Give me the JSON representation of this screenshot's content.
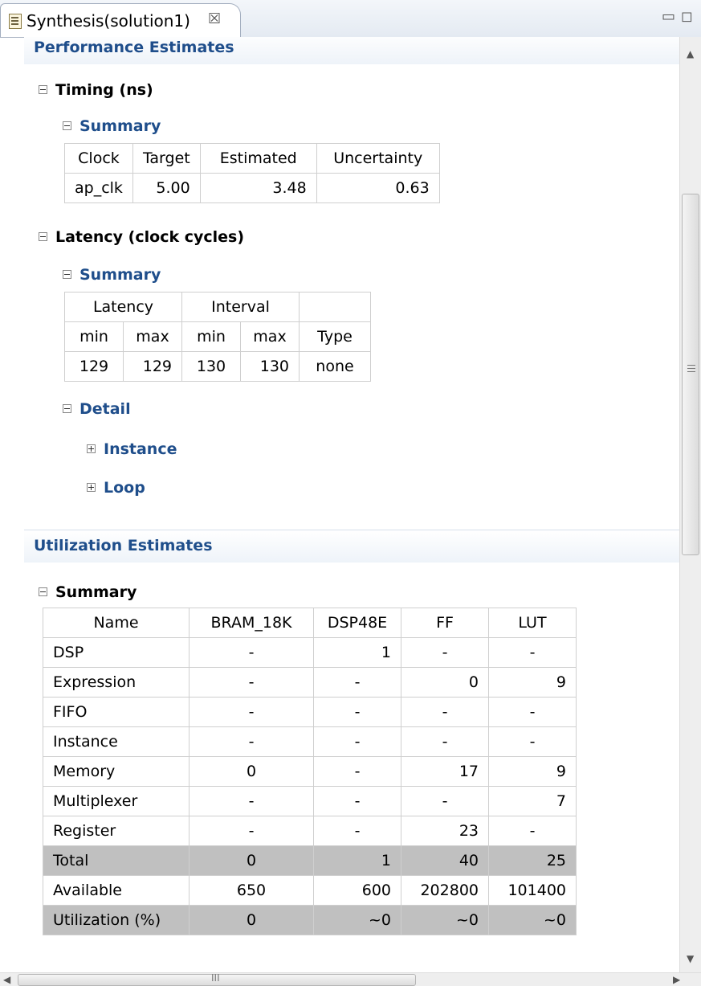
{
  "tab": {
    "title": "Synthesis(solution1)",
    "close": "☒"
  },
  "window": {
    "minimize": "▭",
    "maximize": "◻"
  },
  "perf": {
    "header": "Performance Estimates",
    "timing": {
      "heading": "Timing (ns)",
      "summary_heading": "Summary",
      "headers": [
        "Clock",
        "Target",
        "Estimated",
        "Uncertainty"
      ],
      "row": [
        "ap_clk",
        "5.00",
        "3.48",
        "0.63"
      ]
    },
    "latency": {
      "heading": "Latency (clock cycles)",
      "summary_heading": "Summary",
      "group_headers": [
        "Latency",
        "Interval",
        ""
      ],
      "sub_headers": [
        "min",
        "max",
        "min",
        "max",
        "Type"
      ],
      "row": [
        "129",
        "129",
        "130",
        "130",
        "none"
      ],
      "detail_heading": "Detail",
      "instance": "Instance",
      "loop": "Loop"
    }
  },
  "util": {
    "header": "Utilization Estimates",
    "summary_heading": "Summary",
    "headers": [
      "Name",
      "BRAM_18K",
      "DSP48E",
      "FF",
      "LUT"
    ],
    "rows": [
      [
        "DSP",
        "-",
        "1",
        "-",
        "-"
      ],
      [
        "Expression",
        "-",
        "-",
        "0",
        "9"
      ],
      [
        "FIFO",
        "-",
        "-",
        "-",
        "-"
      ],
      [
        "Instance",
        "-",
        "-",
        "-",
        "-"
      ],
      [
        "Memory",
        "0",
        "-",
        "17",
        "9"
      ],
      [
        "Multiplexer",
        "-",
        "-",
        "-",
        "7"
      ],
      [
        "Register",
        "-",
        "-",
        "23",
        "-"
      ],
      [
        "Total",
        "0",
        "1",
        "40",
        "25"
      ],
      [
        "Available",
        "650",
        "600",
        "202800",
        "101400"
      ],
      [
        "Utilization (%)",
        "0",
        "~0",
        "~0",
        "~0"
      ]
    ]
  },
  "scroll": {
    "grip": "III"
  }
}
